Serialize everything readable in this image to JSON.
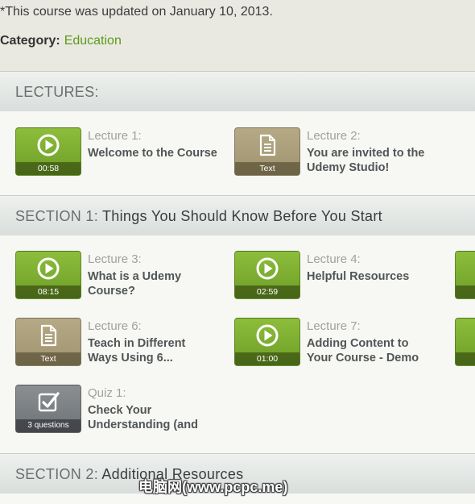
{
  "course": {
    "updated_text": "*This course was updated on January 10, 2013.",
    "category_label": "Category:",
    "category_value": "Education"
  },
  "lectures_header": "LECTURES:",
  "intro_lectures": [
    {
      "number": "Lecture 1:",
      "title": "Welcome to the Course",
      "type": "video",
      "badge": "00:58"
    },
    {
      "number": "Lecture 2:",
      "title": "You are invited to the Udemy Studio!",
      "type": "text",
      "badge": "Text"
    }
  ],
  "section1": {
    "prefix": "SECTION 1:",
    "title": "Things You Should Know Before You Start",
    "items": [
      {
        "number": "Lecture 3:",
        "title": "What is a Udemy Course?",
        "type": "video",
        "badge": "08:15"
      },
      {
        "number": "Lecture 4:",
        "title": "Helpful Resources",
        "type": "video",
        "badge": "02:59"
      },
      {
        "number": "Lecture 6:",
        "title": "Teach in Different Ways Using 6...",
        "type": "text",
        "badge": "Text"
      },
      {
        "number": "Lecture 7:",
        "title": "Adding Content to Your Course - Demo",
        "type": "video",
        "badge": "01:00"
      },
      {
        "number": "Quiz 1:",
        "title": "Check Your Understanding (and",
        "type": "quiz",
        "badge": "3 questions"
      }
    ]
  },
  "section2": {
    "prefix": "SECTION 2:",
    "title": "Additional Resources"
  },
  "watermark": "电脑网(www.pcpc.me)",
  "colors": {
    "video_green": "#7aad2f",
    "text_tan": "#aa9e7b",
    "quiz_gray": "#7c8084",
    "link_green": "#5b9a1c"
  }
}
